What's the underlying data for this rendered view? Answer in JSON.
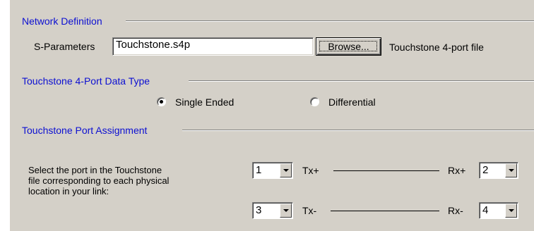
{
  "network_definition": {
    "title": "Network Definition",
    "sparams_label": "S-Parameters",
    "file_value": "Touchstone.s4p",
    "browse_label": "Browse...",
    "file_description": "Touchstone 4-port file"
  },
  "data_type": {
    "title": "Touchstone 4-Port Data Type",
    "options": [
      {
        "label": "Single Ended",
        "selected": true
      },
      {
        "label": "Differential",
        "selected": false
      }
    ]
  },
  "port_assignment": {
    "title": "Touchstone Port Assignment",
    "instructions": [
      "Select the port in the Touchstone",
      "file corresponding to each physical",
      "location in your link:"
    ],
    "rows": [
      {
        "tx_port": "1",
        "tx_label": "Tx+",
        "rx_label": "Rx+",
        "rx_port": "2"
      },
      {
        "tx_port": "3",
        "tx_label": "Tx-",
        "rx_label": "Rx-",
        "rx_port": "4"
      }
    ]
  }
}
